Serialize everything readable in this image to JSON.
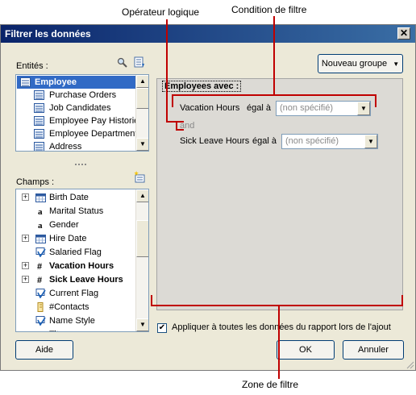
{
  "callouts": {
    "logical_operator": "Opérateur logique",
    "filter_condition": "Condition de filtre",
    "filter_zone": "Zone de filtre"
  },
  "dialog": {
    "title": "Filtrer les données",
    "close_glyph": "✕"
  },
  "entities": {
    "label": "Entités :",
    "new_group_button": "Nouveau groupe",
    "items": [
      {
        "label": "Employee",
        "selected": true
      },
      {
        "label": "Purchase Orders"
      },
      {
        "label": "Job Candidates"
      },
      {
        "label": "Employee Pay Historie"
      },
      {
        "label": "Employee Department"
      },
      {
        "label": "Address"
      }
    ]
  },
  "fields": {
    "label": "Champs :",
    "items": [
      {
        "label": "Birth Date",
        "icon": "calendar-icon",
        "expand": true
      },
      {
        "label": "Marital Status",
        "icon": "text-field-icon"
      },
      {
        "label": "Gender",
        "icon": "text-field-icon"
      },
      {
        "label": "Hire Date",
        "icon": "calendar-icon",
        "expand": true
      },
      {
        "label": "Salaried Flag",
        "icon": "checkbox-field-icon"
      },
      {
        "label": "Vacation Hours",
        "icon": "numeric-field-icon",
        "expand": true,
        "bold": true
      },
      {
        "label": "Sick Leave Hours",
        "icon": "numeric-field-icon",
        "expand": true,
        "bold": true
      },
      {
        "label": "Current Flag",
        "icon": "checkbox-field-icon"
      },
      {
        "label": "#Contacts",
        "icon": "count-field-icon"
      },
      {
        "label": "Name Style",
        "icon": "checkbox-field-icon"
      },
      {
        "label": "Tit",
        "icon": "text-field-icon"
      }
    ]
  },
  "filter": {
    "header": "Employees avec :",
    "conditions": [
      {
        "field": "Vacation Hours",
        "operator": "égal à",
        "value_placeholder": "(non spécifié)"
      },
      {
        "field": "Sick Leave Hours",
        "operator": "égal à",
        "value_placeholder": "(non spécifié)"
      }
    ],
    "logical_operator": "and",
    "apply_all_checked": true,
    "apply_all_label": "Appliquer à toutes les données du rapport lors de l'ajout"
  },
  "buttons": {
    "help": "Aide",
    "ok": "OK",
    "cancel": "Annuler"
  },
  "colors": {
    "callout_lines": "#c00000",
    "title_bar": "#0a246a"
  }
}
